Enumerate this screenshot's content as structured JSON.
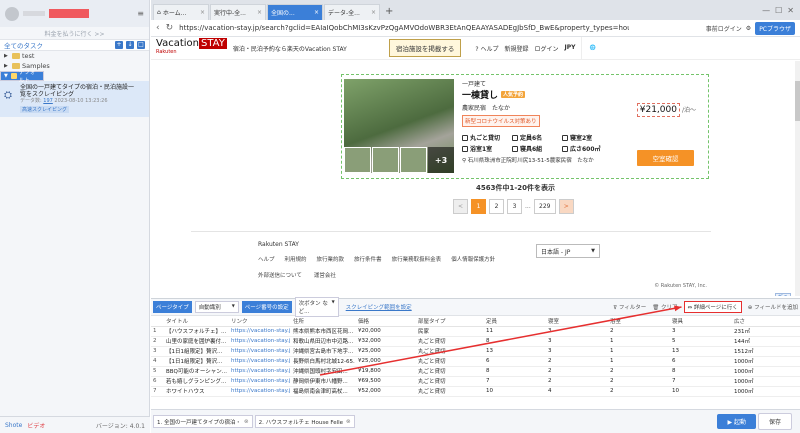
{
  "sidebar": {
    "search_placeholder": "料金を払うに行く >>",
    "all_tasks": "全てのタスク",
    "tree": [
      {
        "label": "test"
      },
      {
        "label": "Samples"
      },
      {
        "label": "デフォルト"
      }
    ],
    "task": {
      "title1": "全国の一戸建てタイプの宿泊・民泊施設一",
      "title2": "覧をスクレイピング",
      "meta_label": "データ数:",
      "meta_count": "197",
      "meta_date": "2023-08-10 13:23:26",
      "badge": "高速スクレイピング"
    },
    "footer": {
      "help": "Shote",
      "video": "ビデオ",
      "version": "バージョン: 4.0.1"
    }
  },
  "browser": {
    "tabs": [
      {
        "label": "ホーム..."
      },
      {
        "label": "実行中-全..."
      },
      {
        "label": "全国の..."
      },
      {
        "label": "データ-全..."
      }
    ],
    "add_tab": "+",
    "url": "https://vacation-stay.jp/search?gclid=EAIaIQobChMI3sKzvPzQgAMVOdoWBR3EtAnQEAAYASADEgJbSfD_BwE&property_types=house&utm_campaign=AW_...",
    "prelogin": "事前ログイン",
    "pc_browser": "PCブラウザ"
  },
  "site": {
    "logo": "Vacation",
    "logo_box": "STAY",
    "logo_sub": "Rakuten",
    "tagline": "宿泊・民泊予約なら楽天のVacation STAY",
    "sell_button": "宿泊施設を掲載する",
    "nav": [
      "ヘルプ",
      "新規登録",
      "ログイン"
    ],
    "currency": "JPY",
    "listing": {
      "subtitle": "一戸建て",
      "title": "一棟貸し",
      "chip": "人気予約",
      "location": "農家民宿　たなか",
      "covid": "新型コロナウイルス対策あり",
      "features": [
        "丸ごと貸切",
        "定員6名",
        "寝室2室",
        "浴室1室",
        "寝具6組",
        "広さ600㎡"
      ],
      "address": "石川県珠洲市正院町川尻13-51-5農家民宿　たなか",
      "price": "¥21,000",
      "price_suffix": "/泊〜",
      "plus": "+3",
      "book_button": "空室確認"
    },
    "results": "4563件中1-20件を表示",
    "pages": [
      "<",
      "1",
      "2",
      "3",
      "...",
      "229",
      ">"
    ],
    "footer": {
      "brand": "Rakuten STAY",
      "links": [
        "ヘルプ",
        "利用規約",
        "旅行業約款",
        "旅行条件書",
        "旅行業務取扱料金表",
        "個人情報保護方針"
      ],
      "links2": [
        "外部送信について",
        "運営会社"
      ],
      "language": "日本語 - JP",
      "copyright": "© Rakuten STAY, Inc.",
      "zoom": "折る"
    }
  },
  "extract": {
    "page_type_label": "ページタイプ",
    "page_type_value": "自動識別",
    "paging_label": "ページ番号の設定",
    "paging_value": "次ボタン など...",
    "scrape_range": "スクレイピング範囲を設定",
    "filter": "フィルター",
    "clear": "クリア",
    "detail": "詳細ページに行く",
    "add_field": "フィールドを追加",
    "columns": [
      "",
      "タイトル",
      "リンク",
      "住所",
      "価格",
      "部屋タイプ",
      "定員",
      "寝室",
      "浴室",
      "寝具",
      "広さ"
    ],
    "rows": [
      [
        "1",
        "【ハウスフォルチェ】...",
        "https://vacation-stay.jp/l/...",
        "熊本県熊本市西区花岡...",
        "¥20,000",
        "民家",
        "11",
        "3",
        "2",
        "3",
        "231㎡"
      ],
      [
        "2",
        "山里の家庭を囲炉裏付...",
        "https://vacation-stay.jp/l/...",
        "和歌山県田辺市中辺路...",
        "¥32,000",
        "丸ごと貸切",
        "8",
        "3",
        "1",
        "5",
        "144㎡"
      ],
      [
        "3",
        "【1日1組限定】贅沢...",
        "https://vacation-stay.jp/l/...",
        "沖縄県宮古島市下地字...",
        "¥25,000",
        "丸ごと貸切",
        "13",
        "3",
        "1",
        "13",
        "1512㎡"
      ],
      [
        "4",
        "【1日1組限定】贅沢...",
        "https://vacation-stay.jp/l/...",
        "長野県白馬村北城12-65...",
        "¥25,000",
        "丸ごと貸切",
        "6",
        "2",
        "1",
        "6",
        "1000㎡"
      ],
      [
        "5",
        "BBQ可能のオーシャン...",
        "https://vacation-stay.jp/l/...",
        "沖縄県国頭村字安田...",
        "¥19,800",
        "丸ごと貸切",
        "8",
        "2",
        "2",
        "8",
        "1000㎡"
      ],
      [
        "6",
        "若も嬉しグランピング...",
        "https://vacation-stay.jp/l/...",
        "静岡県伊東市八幡野...",
        "¥69,500",
        "丸ごと貸切",
        "7",
        "2",
        "2",
        "7",
        "1000㎡"
      ],
      [
        "7",
        "ホワイトハウス",
        "https://vacation-stay.jp/l/...",
        "福島県南会津町高杖...",
        "¥52,000",
        "丸ごと貸切",
        "10",
        "4",
        "2",
        "10",
        "1000㎡"
      ]
    ],
    "bottom_tabs": [
      "1. 全国の一戸建てタイプの宿泊・",
      "2. ハウスフォルチェ House Felle"
    ],
    "run": "▶ 起動",
    "save": "保存"
  }
}
